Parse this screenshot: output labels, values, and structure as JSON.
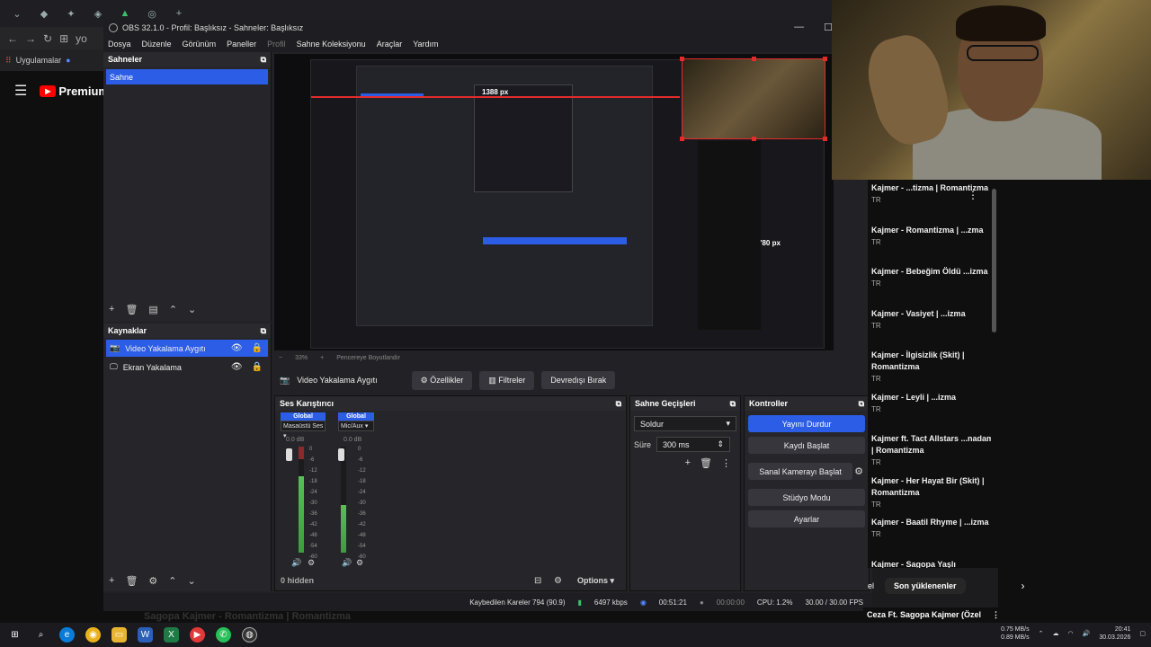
{
  "browser": {
    "tab_icons": [
      "chevron-down",
      "extension",
      "puzzle",
      "pin",
      "audio",
      "target",
      "plus"
    ],
    "addr_snippet": "yo",
    "bookmarks_label": "Uygulamalar",
    "yt_brand": "Premium"
  },
  "obs": {
    "title": "OBS 32.1.0 - Profil: Başlıksız - Sahneler: Başlıksız",
    "menu": [
      "Dosya",
      "Düzenle",
      "Görünüm",
      "Paneller",
      "Profil",
      "Sahne Koleksiyonu",
      "Araçlar",
      "Yardım"
    ],
    "scenes_title": "Sahneler",
    "scene_items": [
      "Sahne"
    ],
    "sources_title": "Kaynaklar",
    "sources": [
      {
        "label": "Video Yakalama Aygıtı",
        "selected": true
      },
      {
        "label": "Ekran Yakalama",
        "selected": false
      }
    ],
    "preview": {
      "width_label": "1388 px",
      "height_label": "780 px",
      "zoom": "33%",
      "fit_label": "Pencereye Boyutlandır"
    },
    "source_toolbar": {
      "source_name": "Video Yakalama Aygıtı",
      "properties": "Özellikler",
      "filters": "Filtreler",
      "deactivate": "Devredışı Bırak"
    },
    "mixer": {
      "title": "Ses Karıştırıcı",
      "channels": [
        {
          "global": "Global",
          "name": "Masaüstü Ses",
          "db": "0.0 dB",
          "level": 0.72
        },
        {
          "global": "Global",
          "name": "Mic/Aux",
          "db": "0.0 dB",
          "level": 0.45
        }
      ],
      "ticks": [
        "0",
        "-6",
        "-12",
        "-18",
        "-24",
        "-30",
        "-36",
        "-42",
        "-48",
        "-54",
        "-60"
      ],
      "hidden": "0 hidden",
      "options": "Options"
    },
    "transitions": {
      "title": "Sahne Geçişleri",
      "type": "Soldur",
      "duration_label": "Süre",
      "duration": "300 ms"
    },
    "controls": {
      "title": "Kontroller",
      "stop_stream": "Yayını Durdur",
      "start_record": "Kaydı Başlat",
      "virtual_cam": "Sanal Kamerayı Başlat",
      "studio_mode": "Stüdyo Modu",
      "settings": "Ayarlar"
    },
    "status": {
      "dropped": "Kaybedilen Kareler 794 (90.9)",
      "bitrate": "6497 kbps",
      "stream_time": "00:51:21",
      "record_time": "00:00:00",
      "cpu": "CPU: 1.2%",
      "fps": "30.00 / 30.00 FPS"
    }
  },
  "playlist": {
    "items": [
      {
        "title": "Kajmer - ...tizma | Romantizma",
        "sub": "TR"
      },
      {
        "title": "Kajmer - Romantizma | ...zma",
        "sub": "TR"
      },
      {
        "title": "Kajmer - Bebeğim Öldü ...izma",
        "sub": "TR"
      },
      {
        "title": "Kajmer - Vasiyet | ...izma",
        "sub": "TR"
      },
      {
        "title": "Kajmer - İlgisizlik (Skit) | Romantizma",
        "sub": "TR"
      },
      {
        "title": "Kajmer - Leyli | ...izma",
        "sub": "TR"
      },
      {
        "title": "Kajmer ft. Tact Allstars ...nadam | Romantizma",
        "sub": "TR"
      },
      {
        "title": "Kajmer - Her Hayat Bir (Skit) | Romantizma",
        "sub": "TR"
      },
      {
        "title": "Kajmer - Baatil Rhyme | ...izma",
        "sub": "TR"
      },
      {
        "title": "Kajmer - Sagopa Yaşlı",
        "sub": ""
      }
    ],
    "chip_left": "el",
    "chip_recent": "Son yüklenenler",
    "next_item": "Ceza Ft. Sagopa Kajmer (Özel",
    "below_title": "Sagopa Kajmer - Romantizma | Romantizma"
  },
  "taskbar": {
    "net_up": "0.75 MB/s",
    "net_down": "0.89 MB/s",
    "time": "20:41",
    "date": "30.03.2026"
  }
}
